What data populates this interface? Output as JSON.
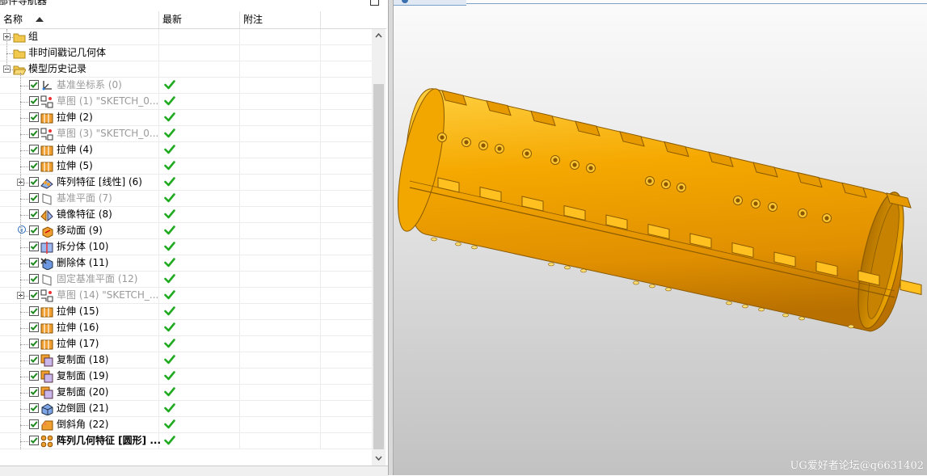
{
  "navigator": {
    "title": "部件导航器",
    "columns": {
      "name": "名称",
      "latest": "最新",
      "comment": "附注"
    },
    "rows": [
      {
        "label": "组",
        "style": "normal",
        "type": "folder",
        "level": 0,
        "expander": "plus",
        "checked": null,
        "latest": false
      },
      {
        "label": "非时间戳记几何体",
        "style": "normal",
        "type": "folder",
        "level": 0,
        "expander": null,
        "checked": null,
        "latest": false
      },
      {
        "label": "模型历史记录",
        "style": "normal",
        "type": "folder-open",
        "level": 0,
        "expander": "minus",
        "checked": null,
        "latest": false
      },
      {
        "label": "基准坐标系 (0)",
        "style": "dim",
        "type": "csys-icon",
        "level": 1,
        "expander": null,
        "checked": true,
        "latest": true
      },
      {
        "label": "草图 (1) \"SKETCH_0...",
        "style": "dim",
        "type": "sketch-icon",
        "level": 1,
        "expander": null,
        "checked": true,
        "latest": true
      },
      {
        "label": "拉伸 (2)",
        "style": "normal",
        "type": "extrude-icon",
        "level": 1,
        "expander": null,
        "checked": true,
        "latest": true
      },
      {
        "label": "草图 (3) \"SKETCH_0...",
        "style": "dim",
        "type": "sketch-icon",
        "level": 1,
        "expander": null,
        "checked": true,
        "latest": true
      },
      {
        "label": "拉伸 (4)",
        "style": "normal",
        "type": "extrude-icon",
        "level": 1,
        "expander": null,
        "checked": true,
        "latest": true
      },
      {
        "label": "拉伸 (5)",
        "style": "normal",
        "type": "extrude-icon",
        "level": 1,
        "expander": null,
        "checked": true,
        "latest": true
      },
      {
        "label": "阵列特征 [线性] (6)",
        "style": "normal",
        "type": "pattern-icon",
        "level": 1,
        "expander": "plus",
        "checked": true,
        "latest": true
      },
      {
        "label": "基准平面 (7)",
        "style": "dim",
        "type": "datum-plane-icon",
        "level": 1,
        "expander": null,
        "checked": true,
        "latest": true
      },
      {
        "label": "镜像特征 (8)",
        "style": "normal",
        "type": "mirror-icon",
        "level": 1,
        "expander": null,
        "checked": true,
        "latest": true
      },
      {
        "label": "移动面 (9)",
        "style": "normal",
        "type": "move-face-icon",
        "level": 1,
        "expander": null,
        "checked": true,
        "latest": true,
        "info": true
      },
      {
        "label": "拆分体 (10)",
        "style": "normal",
        "type": "split-body-icon",
        "level": 1,
        "expander": null,
        "checked": true,
        "latest": true
      },
      {
        "label": "删除体 (11)",
        "style": "normal",
        "type": "delete-body-icon",
        "level": 1,
        "expander": null,
        "checked": true,
        "latest": true
      },
      {
        "label": "固定基准平面 (12)",
        "style": "dim",
        "type": "datum-plane-icon",
        "level": 1,
        "expander": null,
        "checked": true,
        "latest": true
      },
      {
        "label": "草图 (14) \"SKETCH_...",
        "style": "dim",
        "type": "sketch-icon",
        "level": 1,
        "expander": "plus",
        "checked": true,
        "latest": true
      },
      {
        "label": "拉伸 (15)",
        "style": "normal",
        "type": "extrude-icon",
        "level": 1,
        "expander": null,
        "checked": true,
        "latest": true
      },
      {
        "label": "拉伸 (16)",
        "style": "normal",
        "type": "extrude-icon",
        "level": 1,
        "expander": null,
        "checked": true,
        "latest": true
      },
      {
        "label": "拉伸 (17)",
        "style": "normal",
        "type": "extrude-icon",
        "level": 1,
        "expander": null,
        "checked": true,
        "latest": true
      },
      {
        "label": "复制面 (18)",
        "style": "normal",
        "type": "copy-face-icon",
        "level": 1,
        "expander": null,
        "checked": true,
        "latest": true
      },
      {
        "label": "复制面 (19)",
        "style": "normal",
        "type": "copy-face-icon",
        "level": 1,
        "expander": null,
        "checked": true,
        "latest": true
      },
      {
        "label": "复制面 (20)",
        "style": "normal",
        "type": "copy-face-icon",
        "level": 1,
        "expander": null,
        "checked": true,
        "latest": true
      },
      {
        "label": "边倒圆 (21)",
        "style": "normal",
        "type": "edge-blend-icon",
        "level": 1,
        "expander": null,
        "checked": true,
        "latest": true
      },
      {
        "label": "倒斜角 (22)",
        "style": "normal",
        "type": "chamfer-icon",
        "level": 1,
        "expander": null,
        "checked": true,
        "latest": true
      },
      {
        "label": "阵列几何特征 [圆形] ...",
        "style": "bold",
        "type": "pattern-geometry-icon",
        "level": 1,
        "expander": null,
        "checked": true,
        "latest": true
      }
    ]
  },
  "graphics": {
    "watermark": "UG爱好者论坛@q6631402",
    "part_color": "#f5a800",
    "part_edge_color": "#8a5a00"
  }
}
